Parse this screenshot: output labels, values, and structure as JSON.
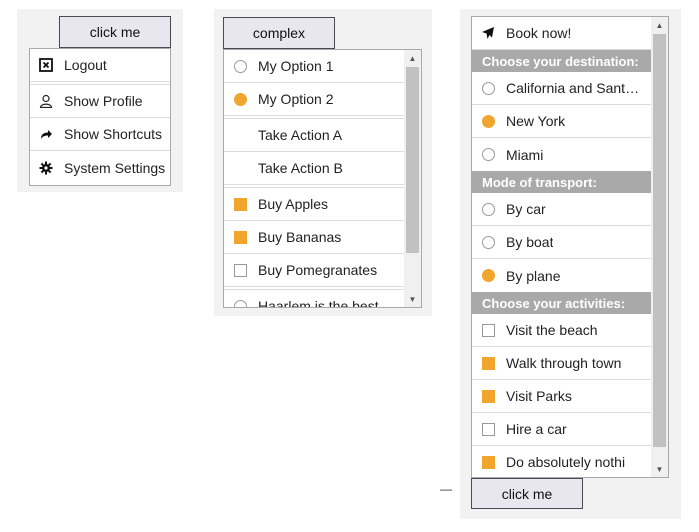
{
  "menu1": {
    "button_label": "click me",
    "items": [
      {
        "label": "Logout",
        "icon": "close-box-icon"
      },
      {
        "label": "Show Profile",
        "icon": "user-icon"
      },
      {
        "label": "Show Shortcuts",
        "icon": "share-arrow-icon"
      },
      {
        "label": "System Settings",
        "icon": "gear-icon"
      }
    ]
  },
  "menu2": {
    "button_label": "complex",
    "items": [
      {
        "label": "My Option 1",
        "type": "radio",
        "checked": false
      },
      {
        "label": "My Option 2",
        "type": "radio",
        "checked": true
      },
      {
        "label": "Take Action A",
        "type": "action"
      },
      {
        "label": "Take Action B",
        "type": "action"
      },
      {
        "label": "Buy Apples",
        "type": "checkbox",
        "checked": true
      },
      {
        "label": "Buy Bananas",
        "type": "checkbox",
        "checked": true
      },
      {
        "label": "Buy Pomegranates",
        "type": "checkbox",
        "checked": false
      },
      {
        "label": "Haarlem is the best",
        "type": "radio",
        "checked": false
      }
    ]
  },
  "menu3": {
    "button_label": "click me",
    "book_label": "Book now!",
    "destination_header": "Choose your destination:",
    "destinations": [
      {
        "label": "California and Sant…",
        "checked": false
      },
      {
        "label": "New York",
        "checked": true
      },
      {
        "label": "Miami",
        "checked": false
      }
    ],
    "transport_header": "Mode of transport:",
    "transports": [
      {
        "label": "By car",
        "checked": false
      },
      {
        "label": "By boat",
        "checked": false
      },
      {
        "label": "By plane",
        "checked": true
      }
    ],
    "activities_header": "Choose your activities:",
    "activities": [
      {
        "label": "Visit the beach",
        "checked": false
      },
      {
        "label": "Walk through town",
        "checked": true
      },
      {
        "label": "Visit Parks",
        "checked": true
      },
      {
        "label": "Hire a car",
        "checked": false
      },
      {
        "label": "Do absolutely nothi",
        "checked": true
      }
    ]
  },
  "dash_text": "—",
  "colors": {
    "accent": "#f0a52c",
    "group_header": "#a9a9a9",
    "button_bg": "#e8e6ee",
    "panel_bg": "#f2f2f2"
  }
}
